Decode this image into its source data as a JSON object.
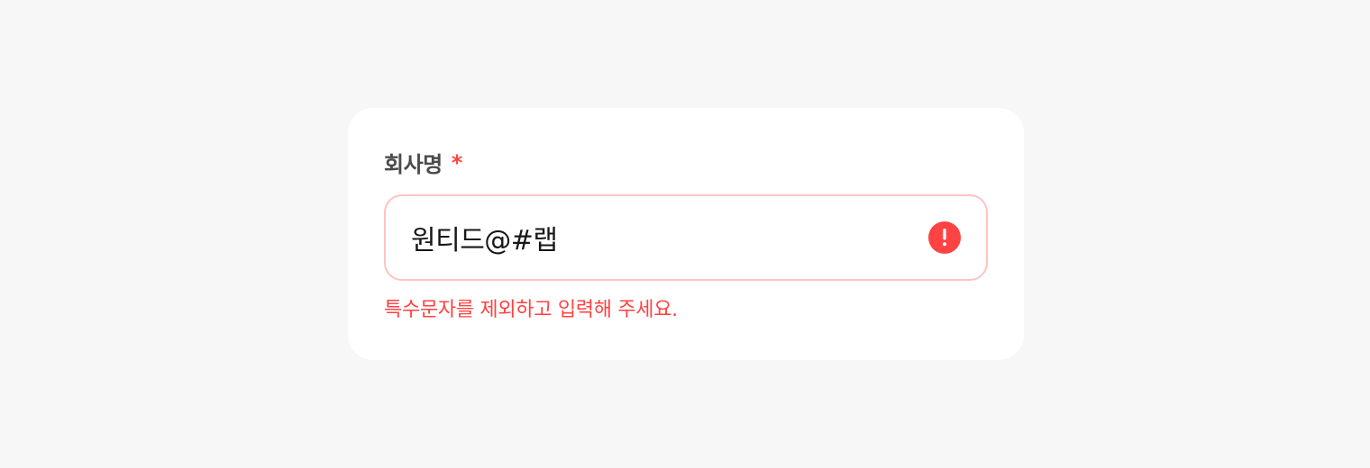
{
  "form": {
    "company_field": {
      "label": "회사명",
      "required_mark": "*",
      "value": "원티드@#랩",
      "error_message": "특수문자를 제외하고 입력해 주세요.",
      "state": "error",
      "error_icon": "exclamation-circle-icon"
    }
  },
  "colors": {
    "background": "#f7f7f7",
    "card": "#ffffff",
    "error": "#ff4242",
    "error_border": "#ffc3c3",
    "label": "#4a4a4a",
    "text": "#171717"
  }
}
